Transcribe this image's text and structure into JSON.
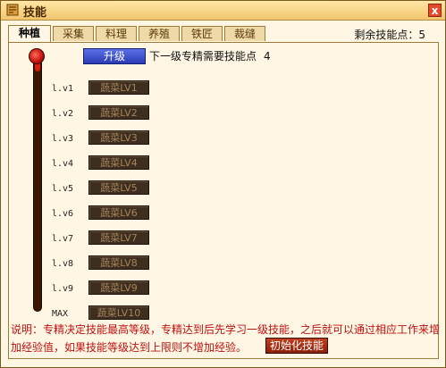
{
  "window": {
    "title": "技能",
    "close_label": "x",
    "icon": "skill-book-icon"
  },
  "tabs": [
    {
      "label": "种植",
      "active": true
    },
    {
      "label": "采集",
      "active": false
    },
    {
      "label": "料理",
      "active": false
    },
    {
      "label": "养殖",
      "active": false
    },
    {
      "label": "铁匠",
      "active": false
    },
    {
      "label": "裁缝",
      "active": false
    }
  ],
  "remaining_points": {
    "label": "剩余技能点：",
    "value": "5"
  },
  "upgrade": {
    "button_label": "升级",
    "next_cost_label": "下一级专精需要技能点",
    "next_cost_value": "4"
  },
  "progress_level_fraction": 0.05,
  "levels": [
    {
      "label": "l.v1",
      "skill": "蔬菜LV1"
    },
    {
      "label": "l.v2",
      "skill": "蔬菜LV2"
    },
    {
      "label": "l.v3",
      "skill": "蔬菜LV3"
    },
    {
      "label": "l.v4",
      "skill": "蔬菜LV4"
    },
    {
      "label": "l.v5",
      "skill": "蔬菜LV5"
    },
    {
      "label": "l.v6",
      "skill": "蔬菜LV6"
    },
    {
      "label": "l.v7",
      "skill": "蔬菜LV7"
    },
    {
      "label": "l.v8",
      "skill": "蔬菜LV8"
    },
    {
      "label": "l.v9",
      "skill": "蔬菜LV9"
    },
    {
      "label": "MAX",
      "skill": "蔬菜LV10"
    }
  ],
  "info_text": "说明：专精决定技能最高等级，专精达到后先学习一级技能，之后就可以通过相应工作来增加经验值，如果技能等级达到上限则不增加经验。",
  "reset_button_label": "初始化技能",
  "colors": {
    "accent": "#2a3cb4",
    "warning_text": "#c01010",
    "panel_bg": "#fff7e4"
  }
}
